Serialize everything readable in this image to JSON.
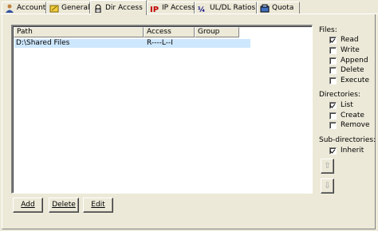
{
  "tabs": [
    {
      "label": "Account",
      "icon": "account-icon"
    },
    {
      "label": "General",
      "icon": "general-icon"
    },
    {
      "label": "Dir Access",
      "icon": "folder-access-icon"
    },
    {
      "label": "IP Access",
      "icon": "ip-icon"
    },
    {
      "label": "UL/DL Ratios",
      "icon": "ratio-icon"
    },
    {
      "label": "Quota",
      "icon": "quota-icon"
    }
  ],
  "active_tab": "Dir Access",
  "list": {
    "columns": [
      "Path",
      "Access",
      "Group"
    ],
    "rows": [
      {
        "path": "D:\\Shared Files",
        "access": "R----L--I",
        "group": ""
      }
    ]
  },
  "buttons": {
    "add": "Add",
    "delete": "Delete",
    "edit": "Edit"
  },
  "files": {
    "label": "Files:",
    "read": "Read",
    "write": "Write",
    "append": "Append",
    "delete": "Delete",
    "execute": "Execute"
  },
  "directories": {
    "label": "Directories:",
    "list": "List",
    "create": "Create",
    "remove": "Remove"
  },
  "subdirectories": {
    "label": "Sub-directories:",
    "inherit": "Inherit"
  },
  "colors": {
    "selection": "#cde7fd",
    "face": "#ece9d8"
  }
}
